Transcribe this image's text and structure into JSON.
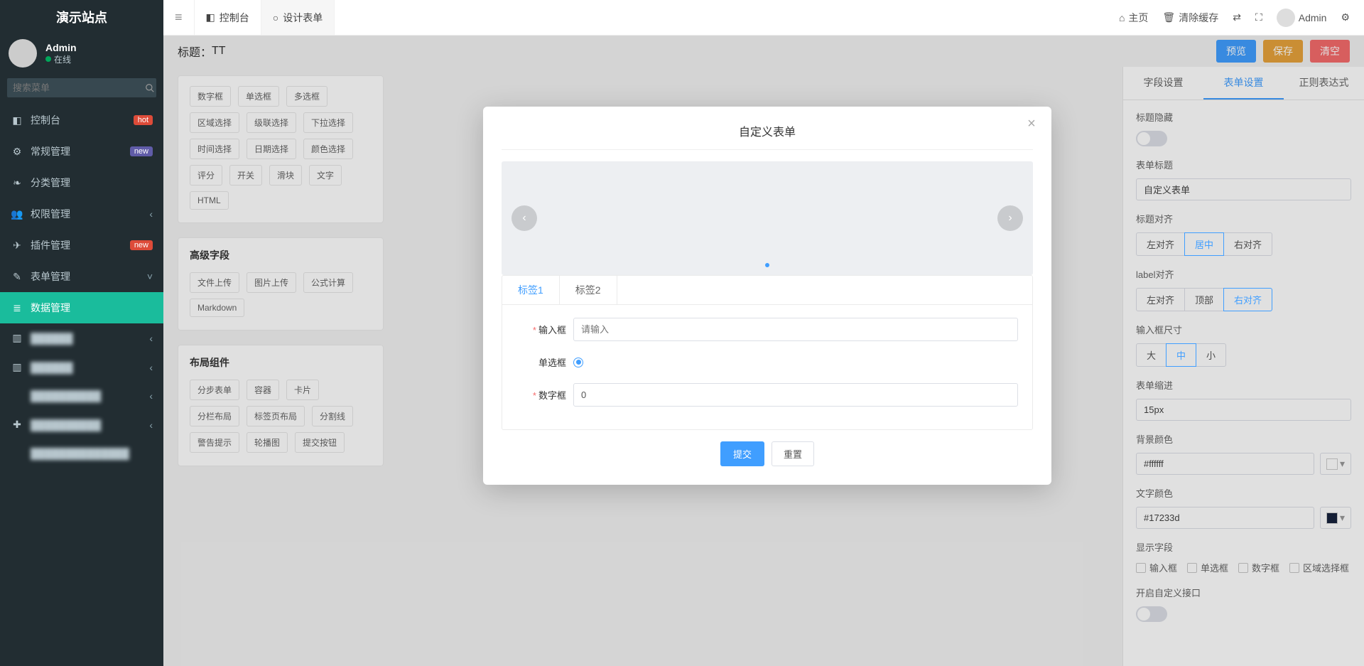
{
  "brand": "演示站点",
  "user": {
    "name": "Admin",
    "status": "在线"
  },
  "sidebar": {
    "search_placeholder": "搜索菜单",
    "items": [
      {
        "icon": "◧",
        "label": "控制台",
        "badge": "hot",
        "badge_cls": "hot"
      },
      {
        "icon": "⚙",
        "label": "常规管理",
        "badge": "new",
        "badge_cls": "new"
      },
      {
        "icon": "❧",
        "label": "分类管理"
      },
      {
        "icon": "👥",
        "label": "权限管理",
        "chev": true
      },
      {
        "icon": "✈",
        "label": "插件管理",
        "badge": "new",
        "badge_cls": "new2"
      },
      {
        "icon": "✎",
        "label": "表单管理",
        "chev_open": true
      },
      {
        "icon": "≣",
        "label": "数据管理",
        "active": true
      },
      {
        "icon": "▥",
        "label": "██████",
        "chev": true,
        "blur": true
      },
      {
        "icon": "▥",
        "label": "██████",
        "chev": true,
        "blur": true
      },
      {
        "icon": "",
        "label": "██████████",
        "chev": true,
        "blur": true
      },
      {
        "icon": "✚",
        "label": "██████████",
        "chev": true,
        "blur": true
      },
      {
        "icon": "",
        "label": "██████████████",
        "blur": true
      }
    ]
  },
  "topbar": {
    "hamburger": "≡",
    "tabs": [
      {
        "icon": "◧",
        "label": "控制台"
      },
      {
        "icon": "○",
        "label": "设计表单",
        "active": true
      }
    ],
    "right": {
      "home": "主页",
      "clear": "清除缓存",
      "user": "Admin"
    }
  },
  "titlebar": {
    "label": "标题：",
    "value": "TT",
    "actions": {
      "preview": "预览",
      "save": "保存",
      "clear": "清空"
    }
  },
  "palette": {
    "basic_tags": [
      "数字框",
      "单选框",
      "多选框",
      "区域选择",
      "级联选择",
      "下拉选择",
      "时间选择",
      "日期选择",
      "颜色选择",
      "评分",
      "开关",
      "滑块",
      "文字",
      "HTML"
    ],
    "adv_title": "高级字段",
    "adv_tags": [
      "文件上传",
      "图片上传",
      "公式计算",
      "Markdown"
    ],
    "layout_title": "布局组件",
    "layout_tags": [
      "分步表单",
      "容器",
      "卡片",
      "分栏布局",
      "标签页布局",
      "分割线",
      "警告提示",
      "轮播图",
      "提交按钮"
    ]
  },
  "rpanel": {
    "tabs": [
      "字段设置",
      "表单设置",
      "正则表达式"
    ],
    "active_tab": 1,
    "labels": {
      "title_hidden": "标题隐藏",
      "form_title": "表单标题",
      "title_align": "标题对齐",
      "label_align": "label对齐",
      "input_size": "输入框尺寸",
      "indent": "表单缩进",
      "bg": "背景颜色",
      "fg": "文字颜色",
      "show_fields": "显示字段",
      "custom_api": "开启自定义接口"
    },
    "form_title_value": "自定义表单",
    "title_align_opts": [
      "左对齐",
      "居中",
      "右对齐"
    ],
    "title_align_active": 1,
    "label_align_opts": [
      "左对齐",
      "顶部",
      "右对齐"
    ],
    "label_align_active": 2,
    "size_opts": [
      "大",
      "中",
      "小"
    ],
    "size_active": 1,
    "indent_value": "15px",
    "bg_value": "#ffffff",
    "fg_value": "#17233d",
    "show_fields_opts": [
      "输入框",
      "单选框",
      "数字框",
      "区域选择框"
    ]
  },
  "modal": {
    "title": "自定义表单",
    "tabs": [
      "标签1",
      "标签2"
    ],
    "active_tab": 0,
    "rows": {
      "input_label": "输入框",
      "input_placeholder": "请输入",
      "radio_label": "单选框",
      "number_label": "数字框",
      "number_value": "0"
    },
    "submit": "提交",
    "reset": "重置"
  }
}
